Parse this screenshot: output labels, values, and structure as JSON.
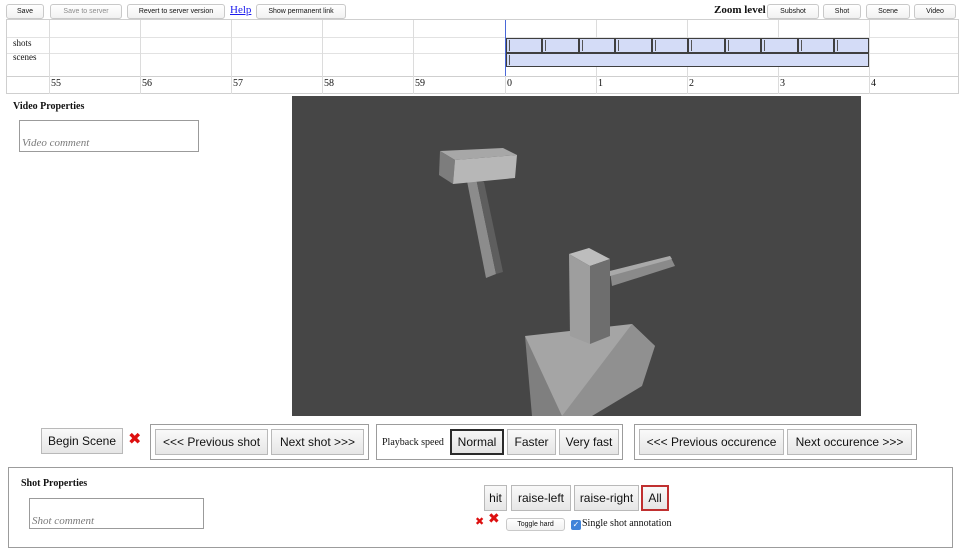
{
  "toolbar": {
    "save": "Save",
    "save_to_server": "Save to server",
    "revert": "Revert to server version",
    "help": "Help",
    "permalink": "Show permanent link",
    "zoom_label": "Zoom level",
    "zoom_subshot": "Subshot",
    "zoom_shot": "Shot",
    "zoom_scene": "Scene",
    "zoom_video": "Video"
  },
  "timeline": {
    "row_labels": [
      "shots",
      "scenes"
    ],
    "ticks": [
      "55",
      "56",
      "57",
      "58",
      "59",
      "0",
      "1",
      "2",
      "3",
      "4"
    ]
  },
  "video_properties": {
    "title": "Video Properties",
    "comment_placeholder": "Video comment"
  },
  "controls": {
    "begin_scene": "Begin Scene",
    "prev_shot": "<<< Previous shot",
    "next_shot": "Next shot >>>",
    "playback_label": "Playback speed",
    "speed_normal": "Normal",
    "speed_faster": "Faster",
    "speed_very_fast": "Very fast",
    "prev_occurence": "<<< Previous occurence",
    "next_occurence": "Next occurence >>>"
  },
  "shot_properties": {
    "title": "Shot Properties",
    "comment_placeholder": "Shot comment",
    "labels": [
      "hit",
      "raise-left",
      "raise-right",
      "All"
    ],
    "toggle_hard": "Toggle hard",
    "single_shot": "Single shot annotation",
    "single_shot_checked": true
  },
  "colors": {
    "segment_fill": "#d4dcf7",
    "cursor": "#4a68d8",
    "video_bg": "#464646",
    "delete_red": "#dd0f0f"
  }
}
